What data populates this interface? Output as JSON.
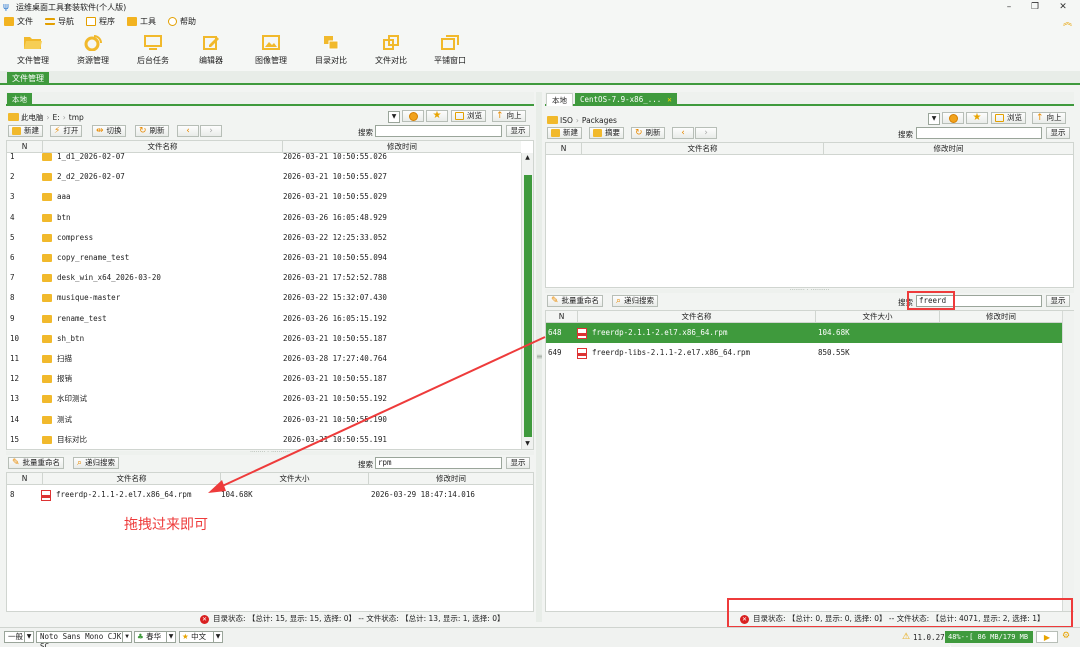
{
  "window": {
    "title": "运维桌面工具套装软件(个人版)",
    "minimize_glyph": "–",
    "maximize_glyph": "❐",
    "close_glyph": "✕"
  },
  "menu": [
    "文件",
    "导航",
    "程序",
    "工具",
    "帮助"
  ],
  "ribbon": [
    "文件管理",
    "资源管理",
    "后台任务",
    "编辑器",
    "图像管理",
    "目录对比",
    "文件对比",
    "平铺窗口"
  ],
  "function_tab": "文件管理",
  "left": {
    "tab": "本地",
    "path": [
      "此电脑",
      "E:",
      "tmp"
    ],
    "toolbar": {
      "browse": "浏览",
      "up": "向上",
      "new": "新建",
      "open": "打开",
      "switch": "切换",
      "refresh": "刷新",
      "search_label": "搜索",
      "show": "显示"
    },
    "columns": [
      "N",
      "文件名称",
      "修改时间"
    ],
    "files": [
      {
        "n": "1",
        "name": "1_d1_2026-02-07",
        "time": "2026-03-21 10:50:55.026"
      },
      {
        "n": "2",
        "name": "2_d2_2026-02-07",
        "time": "2026-03-21 10:50:55.027"
      },
      {
        "n": "3",
        "name": "aaa",
        "time": "2026-03-21 10:50:55.029"
      },
      {
        "n": "4",
        "name": "btn",
        "time": "2026-03-26 16:05:48.929"
      },
      {
        "n": "5",
        "name": "compress",
        "time": "2026-03-22 12:25:33.052"
      },
      {
        "n": "6",
        "name": "copy_rename_test",
        "time": "2026-03-21 10:50:55.094"
      },
      {
        "n": "7",
        "name": "desk_win_x64_2026-03-20",
        "time": "2026-03-21 17:52:52.788"
      },
      {
        "n": "8",
        "name": "musique-master",
        "time": "2026-03-22 15:32:07.430"
      },
      {
        "n": "9",
        "name": "rename_test",
        "time": "2026-03-26 16:05:15.192"
      },
      {
        "n": "10",
        "name": "sh_btn",
        "time": "2026-03-21 10:50:55.187"
      },
      {
        "n": "11",
        "name": "扫描",
        "time": "2026-03-28 17:27:40.764"
      },
      {
        "n": "12",
        "name": "报销",
        "time": "2026-03-21 10:50:55.187"
      },
      {
        "n": "13",
        "name": "水印测试",
        "time": "2026-03-21 10:50:55.192"
      },
      {
        "n": "14",
        "name": "测试",
        "time": "2026-03-21 10:50:55.190"
      },
      {
        "n": "15",
        "name": "目标对比",
        "time": "2026-03-21 10:50:55.191"
      }
    ],
    "lower": {
      "batch_rename": "批量重命名",
      "recursive_search": "递归搜索",
      "search_label": "搜索",
      "search_value": "rpm",
      "show": "显示",
      "columns": [
        "N",
        "文件名称",
        "文件大小",
        "修改时间"
      ],
      "files": [
        {
          "n": "8",
          "name": "freerdp-2.1.1-2.el7.x86_64.rpm",
          "size": "104.68K",
          "time": "2026-03-29 18:47:14.016"
        }
      ]
    },
    "status": "目录状态: 【总计: 15, 显示: 15, 选择: 0】 -- 文件状态: 【总计: 13, 显示: 1, 选择: 0】"
  },
  "right": {
    "tabs": [
      "本地",
      "CentOS-7.9-x86_..."
    ],
    "path": [
      "ISO",
      "Packages"
    ],
    "toolbar": {
      "browse": "浏览",
      "up": "向上",
      "new": "新建",
      "summary": "摘要",
      "refresh": "刷新",
      "search_label": "搜索",
      "show": "显示"
    },
    "columns": [
      "N",
      "文件名称",
      "修改时间"
    ],
    "lower": {
      "batch_rename": "批量重命名",
      "recursive_search": "递归搜索",
      "search_label": "搜索",
      "search_value": "freerd",
      "show": "显示",
      "columns": [
        "N",
        "文件名称",
        "文件大小",
        "修改时间"
      ],
      "files": [
        {
          "n": "648",
          "name": "freerdp-2.1.1-2.el7.x86_64.rpm",
          "size": "104.68K",
          "time": "",
          "selected": true
        },
        {
          "n": "649",
          "name": "freerdp-libs-2.1.1-2.el7.x86_64.rpm",
          "size": "850.55K",
          "time": "",
          "selected": false
        }
      ]
    },
    "status": "目录状态: 【总计: 0, 显示: 0, 选择: 0】 -- 文件状态: 【总计: 4071, 显示: 2, 选择: 1】"
  },
  "annotation": {
    "text": "拖拽过来即可",
    "color": "#ee3b3b"
  },
  "bottombar": {
    "mode": "一般",
    "font": "Noto Sans Mono CJK SC",
    "season": "春华",
    "language": "中文",
    "version": "11.0.27",
    "memory": "48%--[ 86 MB/179 MB ]"
  },
  "colors": {
    "accent": "#3f9a3d",
    "folder": "#f1b92c",
    "error": "#d92020"
  }
}
